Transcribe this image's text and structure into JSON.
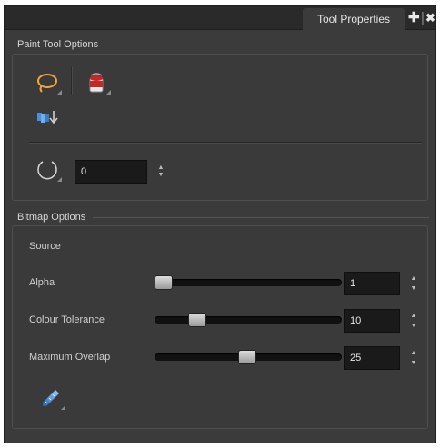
{
  "window": {
    "tab_label": "Tool Properties",
    "add_glyph": "✚",
    "close_glyph": "✖",
    "divider_glyph": "|"
  },
  "paint_tool_options": {
    "title": "Paint Tool Options",
    "tools": [
      {
        "name": "lasso-icon"
      },
      {
        "name": "paint-bucket-icon"
      },
      {
        "name": "apply-to-all-drawings-icon"
      }
    ],
    "rotation": {
      "icon": "circle-arrow-icon",
      "value": "0"
    }
  },
  "bitmap_options": {
    "title": "Bitmap Options",
    "source_label": "Source",
    "sliders": [
      {
        "label": "Alpha",
        "value": "1",
        "fraction": 0.0
      },
      {
        "label": "Colour Tolerance",
        "value": "10",
        "fraction": 0.23
      },
      {
        "label": "Maximum Overlap",
        "value": "25",
        "fraction": 0.5
      }
    ],
    "tool_icon": "pen-gradient-icon"
  },
  "colors": {
    "panel_bg": "#3b3b3b",
    "field_bg": "#1a1a1a",
    "accent_blue": "#3b8ee8",
    "bucket_red": "#c62828",
    "lasso_orange": "#f2a33a"
  }
}
